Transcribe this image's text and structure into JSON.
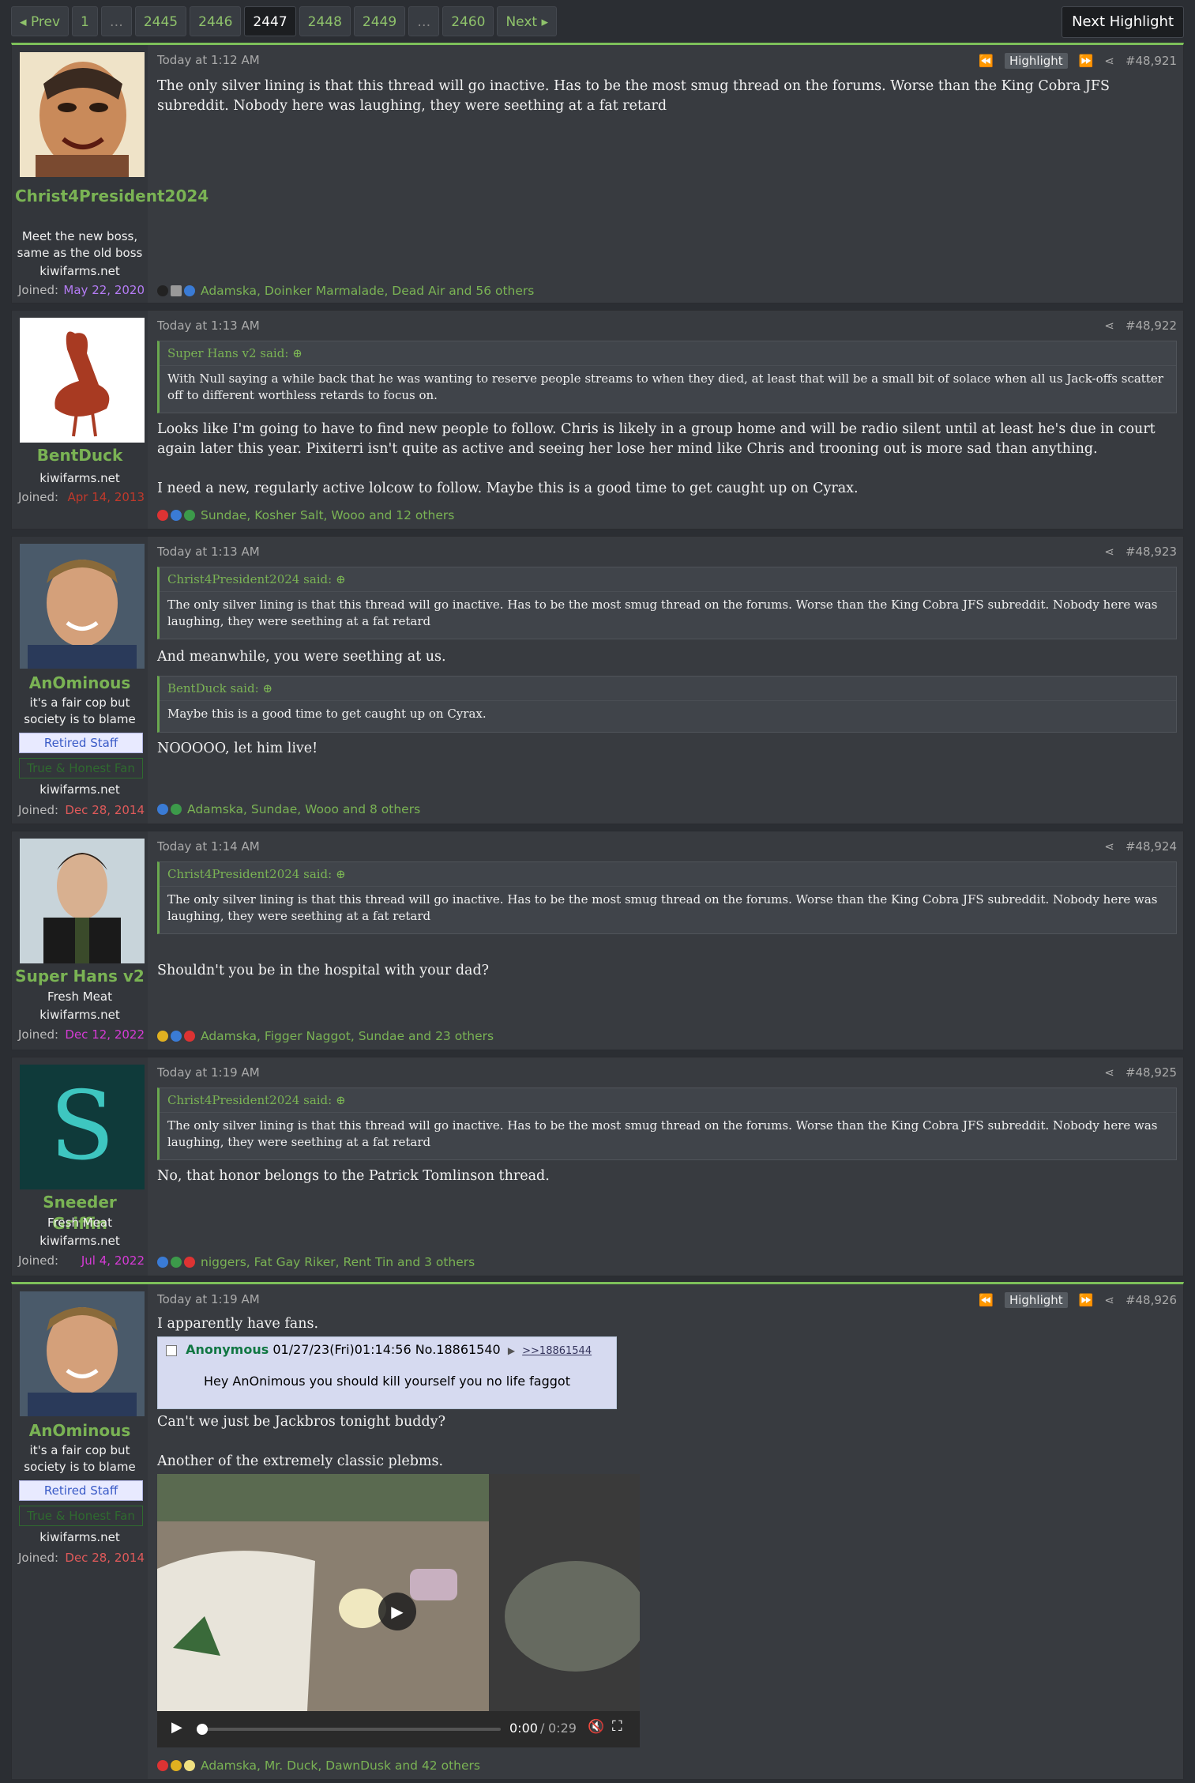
{
  "pagination": {
    "prev": "Prev",
    "pages": [
      "1",
      "…",
      "2445",
      "2446",
      "2447",
      "2448",
      "2449",
      "…",
      "2460"
    ],
    "current": "2447",
    "next": "Next"
  },
  "next_highlight": "Next Highlight",
  "highlight_label": "Highlight",
  "posts": [
    {
      "user": {
        "name": "Christ4President2024",
        "title": "Meet the new boss, same as the old boss",
        "site": "kiwifarms.net",
        "joined_label": "Joined:",
        "joined": "May 22, 2020",
        "joined_color": "#b57cf5"
      },
      "time": "Today at 1:12 AM",
      "number": "#48,921",
      "body": [
        "The only silver lining is that this thread will go inactive. Has to be the most smug thread on the forums. Worse than the King Cobra JFS subreddit. Nobody here was laughing, they were seething at a fat retard"
      ],
      "reactions": "Adamska, Doinker Marmalade, Dead Air and 56 others"
    },
    {
      "user": {
        "name": "BentDuck",
        "site": "kiwifarms.net",
        "joined_label": "Joined:",
        "joined": "Apr 14, 2013",
        "joined_color": "#c0392b"
      },
      "time": "Today at 1:13 AM",
      "number": "#48,922",
      "quote": {
        "author": "Super Hans v2 said:",
        "text": "With Null saying a while back that he was wanting to reserve people streams to when they died, at least that will be a small bit of solace when all us Jack-offs scatter off to different worthless retards to focus on."
      },
      "body": [
        "Looks like I'm going to have to find new people to follow. Chris is likely in a group home and will be radio silent until at least he's due in court again later this year. Pixiterri isn't quite as active and seeing her lose her mind like Chris and trooning out is more sad than anything.",
        "I need a new, regularly active lolcow to follow. Maybe this is a good time to get caught up on Cyrax."
      ],
      "reactions": "Sundae, Kosher Salt, Wooo and 12 others"
    },
    {
      "user": {
        "name": "AnOminous",
        "title": "it's a fair cop but society is to blame",
        "badge1": "Retired Staff",
        "badge2": "True & Honest Fan",
        "site": "kiwifarms.net",
        "joined_label": "Joined:",
        "joined": "Dec 28, 2014",
        "joined_color": "#e05a5a"
      },
      "time": "Today at 1:13 AM",
      "number": "#48,923",
      "quote": {
        "author": "Christ4President2024 said:",
        "text": "The only silver lining is that this thread will go inactive. Has to be the most smug thread on the forums. Worse than the King Cobra JFS subreddit. Nobody here was laughing, they were seething at a fat retard"
      },
      "body_a": "And meanwhile, you were seething at us.",
      "quote2": {
        "author": "BentDuck said:",
        "text": "Maybe this is a good time to get caught up on Cyrax."
      },
      "body_b": "NOOOOO, let him live!",
      "reactions": "Adamska, Sundae, Wooo and 8 others"
    },
    {
      "user": {
        "name": "Super Hans v2",
        "title": "Fresh Meat",
        "site": "kiwifarms.net",
        "joined_label": "Joined:",
        "joined": "Dec 12, 2022",
        "joined_color": "#d63bd6"
      },
      "time": "Today at 1:14 AM",
      "number": "#48,924",
      "quote": {
        "author": "Christ4President2024 said:",
        "text": "The only silver lining is that this thread will go inactive. Has to be the most smug thread on the forums. Worse than the King Cobra JFS subreddit. Nobody here was laughing, they were seething at a fat retard"
      },
      "body": [
        "Shouldn't you be in the hospital with your dad?"
      ],
      "reactions": "Adamska, Figger Naggot, Sundae and 23 others"
    },
    {
      "user": {
        "name": "Sneeder Griffin",
        "title": "Fresh Meat",
        "site": "kiwifarms.net",
        "joined_label": "Joined:",
        "joined": "Jul 4, 2022",
        "joined_color": "#d63bd6",
        "letter": "S"
      },
      "time": "Today at 1:19 AM",
      "number": "#48,925",
      "quote": {
        "author": "Christ4President2024 said:",
        "text": "The only silver lining is that this thread will go inactive. Has to be the most smug thread on the forums. Worse than the King Cobra JFS subreddit. Nobody here was laughing, they were seething at a fat retard"
      },
      "body": [
        "No, that honor belongs to the Patrick Tomlinson thread."
      ],
      "reactions": "niggers, Fat Gay Riker, Rent Tin and 3 others"
    },
    {
      "user": {
        "name": "AnOminous",
        "title": "it's a fair cop but society is to blame",
        "badge1": "Retired Staff",
        "badge2": "True & Honest Fan",
        "site": "kiwifarms.net",
        "joined_label": "Joined:",
        "joined": "Dec 28, 2014",
        "joined_color": "#e05a5a"
      },
      "time": "Today at 1:19 AM",
      "number": "#48,926",
      "body_a": "I apparently have fans.",
      "chan": {
        "name": "Anonymous",
        "meta": "01/27/23(Fri)01:14:56 No.18861540",
        "link": ">>18861544",
        "text": "Hey AnOnimous you should kill yourself you no life faggot"
      },
      "body_b": "Can't we just be Jackbros tonight buddy?",
      "body_c": "Another of the extremely classic plebms.",
      "video": {
        "time": "0:00",
        "sep": "/",
        "duration": "0:29",
        "progress": 0
      },
      "reactions": "Adamska, Mr. Duck, DawnDusk and 42 others"
    }
  ]
}
